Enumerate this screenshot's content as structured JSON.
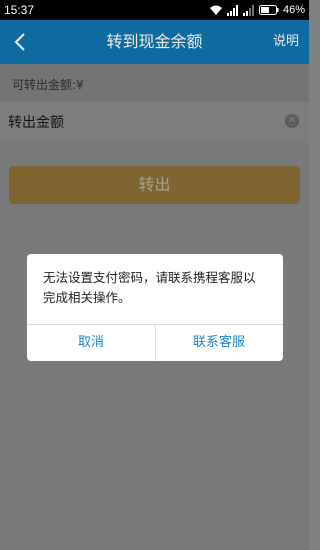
{
  "status_bar": {
    "time": "15:37",
    "battery": "46%"
  },
  "nav": {
    "title": "转到现金余额",
    "help_label": "说明"
  },
  "form": {
    "available_label": "可转出金额:¥",
    "amount_label": "转出金额",
    "amount_value": "",
    "transfer_button_label": "转出"
  },
  "dialog": {
    "message": "无法设置支付密码，请联系携程客服以完成相关操作。",
    "cancel_label": "取消",
    "contact_label": "联系客服"
  },
  "colors": {
    "nav_bg": "#0f6aa0",
    "transfer_button_bg": "#7e6531",
    "dialog_button_text": "#1f86c8"
  }
}
